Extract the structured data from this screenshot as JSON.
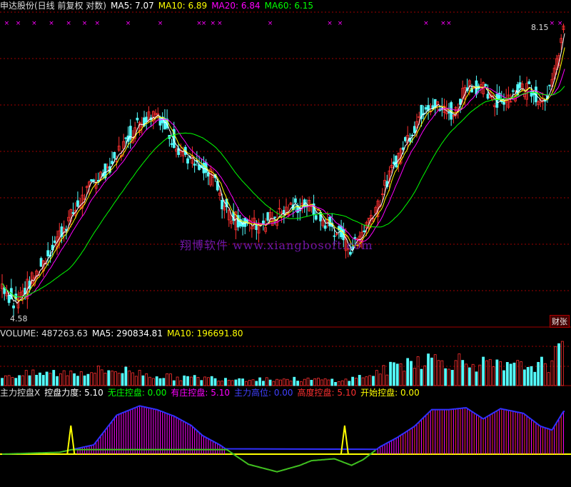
{
  "header_main": {
    "stock": "申达股份(日线 前复权 对数)",
    "ma5": "MA5: 7.07",
    "ma10": "MA10: 6.89",
    "ma20": "MA20: 6.84",
    "ma60": "MA60: 6.15"
  },
  "header_volume": {
    "volume": "VOLUME: 487263.63",
    "ma5": "MA5: 290834.81",
    "ma10": "MA10: 196691.80"
  },
  "header_indicator": {
    "name": "主力控盘X",
    "force": "控盘力度: 5.10",
    "none": "无庄控盘: 0.00",
    "has": "有庄控盘: 5.10",
    "high": "主力高位: 0.00",
    "height": "高度控盘: 5.10",
    "start": "开始控盘: 0.00"
  },
  "labels": {
    "high_price": "8.15",
    "low_price": "4.58",
    "watermark": "翔博软件 www.xiangbosoft.com",
    "badge": "财张"
  },
  "colors": {
    "up": "#ff3030",
    "down": "#54ffff",
    "ma5": "#ffffff",
    "ma10": "#ffff00",
    "ma20": "#ff00ff",
    "ma60": "#00ff00",
    "grid": "#a00000"
  },
  "chart_data": {
    "type": "candlestick",
    "scale": "log",
    "price_range": [
      4.58,
      8.15
    ],
    "close_anchors": [
      [
        0,
        4.9
      ],
      [
        10,
        4.7
      ],
      [
        30,
        5.0
      ],
      [
        50,
        5.4
      ],
      [
        70,
        5.8
      ],
      [
        80,
        6.0
      ],
      [
        95,
        6.2
      ],
      [
        110,
        6.55
      ],
      [
        120,
        6.75
      ],
      [
        135,
        6.9
      ],
      [
        145,
        6.6
      ],
      [
        155,
        6.4
      ],
      [
        165,
        6.25
      ],
      [
        175,
        6.1
      ],
      [
        185,
        6.05
      ],
      [
        190,
        5.8
      ],
      [
        200,
        5.6
      ],
      [
        215,
        5.5
      ],
      [
        230,
        5.55
      ],
      [
        245,
        5.65
      ],
      [
        265,
        5.75
      ],
      [
        280,
        5.55
      ],
      [
        295,
        5.4
      ],
      [
        305,
        5.25
      ],
      [
        315,
        5.45
      ],
      [
        330,
        5.8
      ],
      [
        345,
        6.3
      ],
      [
        360,
        6.7
      ],
      [
        370,
        7.0
      ],
      [
        380,
        6.95
      ],
      [
        395,
        6.85
      ],
      [
        405,
        7.3
      ],
      [
        420,
        7.2
      ],
      [
        430,
        7.0
      ],
      [
        445,
        7.15
      ],
      [
        460,
        7.25
      ],
      [
        470,
        7.05
      ],
      [
        480,
        7.25
      ],
      [
        490,
        8.15
      ]
    ],
    "indicator_anchors": [
      [
        0,
        0
      ],
      [
        50,
        0.2
      ],
      [
        80,
        1.0
      ],
      [
        100,
        4.2
      ],
      [
        120,
        5.2
      ],
      [
        135,
        4.8
      ],
      [
        150,
        4.1
      ],
      [
        165,
        3.1
      ],
      [
        175,
        2.0
      ],
      [
        190,
        1.0
      ],
      [
        215,
        -1.1
      ],
      [
        240,
        -1.9
      ],
      [
        260,
        -1.2
      ],
      [
        270,
        -0.7
      ],
      [
        290,
        -0.5
      ],
      [
        305,
        -1.2
      ],
      [
        315,
        -0.6
      ],
      [
        330,
        0.8
      ],
      [
        345,
        1.8
      ],
      [
        360,
        3.0
      ],
      [
        375,
        4.8
      ],
      [
        390,
        4.8
      ],
      [
        405,
        5.0
      ],
      [
        420,
        3.8
      ],
      [
        435,
        4.9
      ],
      [
        455,
        4.4
      ],
      [
        470,
        3.0
      ],
      [
        480,
        2.6
      ],
      [
        490,
        4.6
      ]
    ],
    "indicator_signal_spikes": [
      60,
      299
    ]
  }
}
